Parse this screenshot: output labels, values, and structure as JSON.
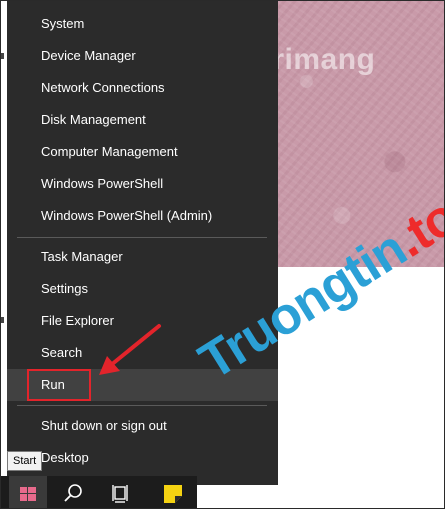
{
  "menu": {
    "group1": [
      "System",
      "Device Manager",
      "Network Connections",
      "Disk Management",
      "Computer Management",
      "Windows PowerShell",
      "Windows PowerShell (Admin)"
    ],
    "group2": [
      "Task Manager",
      "Settings",
      "File Explorer",
      "Search",
      "Run"
    ],
    "group3": [
      "Shut down or sign out",
      "Desktop"
    ],
    "highlighted_item": "Run"
  },
  "tooltip": "Start",
  "taskbar": {
    "icons": [
      "windows-logo-icon",
      "search-icon",
      "task-view-icon",
      "sticky-notes-icon"
    ]
  },
  "watermarks": {
    "top_text": "uantrimang",
    "bottom_main": "Truongtin",
    "bottom_dot": ".",
    "bottom_tld": "top"
  },
  "colors": {
    "menu_bg": "#2b2b2b",
    "highlight": "#414141",
    "annotation_red": "#e3242b",
    "brand_blue": "#2ba0d6"
  }
}
